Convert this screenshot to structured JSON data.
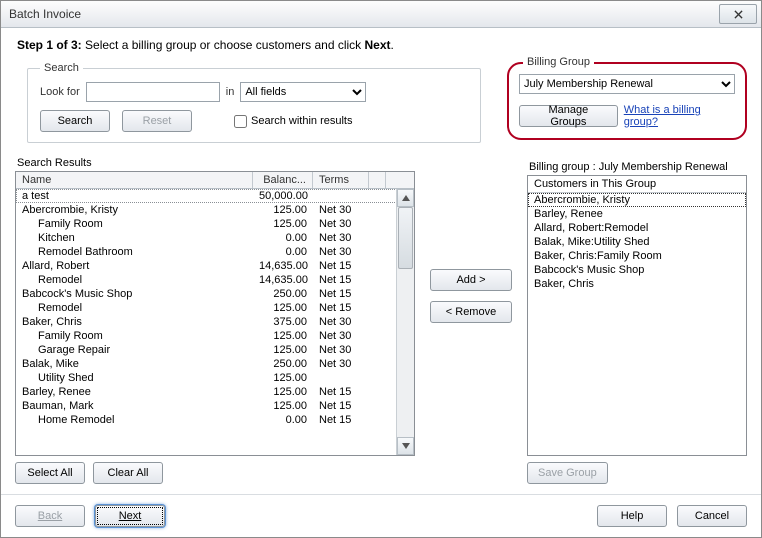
{
  "window": {
    "title": "Batch Invoice"
  },
  "step": {
    "prefix": "Step 1 of 3:",
    "text": " Select a billing group or choose customers and click ",
    "next": "Next",
    "suffix": "."
  },
  "search": {
    "legend": "Search",
    "look_for_label": "Look for",
    "look_for_value": "",
    "in_label": "in",
    "field_options": [
      "All fields"
    ],
    "field_value": "All fields",
    "search_btn": "Search",
    "reset_btn": "Reset",
    "within_label": "Search within results"
  },
  "results": {
    "label": "Search Results",
    "columns": {
      "name": "Name",
      "balance": "Balanc...",
      "terms": "Terms"
    },
    "rows": [
      {
        "name": "a test",
        "balance": "50,000.00",
        "terms": "",
        "indent": 0,
        "selected": true
      },
      {
        "name": "Abercrombie, Kristy",
        "balance": "125.00",
        "terms": "Net 30",
        "indent": 0
      },
      {
        "name": "Family Room",
        "balance": "125.00",
        "terms": "Net 30",
        "indent": 1
      },
      {
        "name": "Kitchen",
        "balance": "0.00",
        "terms": "Net 30",
        "indent": 1
      },
      {
        "name": "Remodel Bathroom",
        "balance": "0.00",
        "terms": "Net 30",
        "indent": 1
      },
      {
        "name": "Allard, Robert",
        "balance": "14,635.00",
        "terms": "Net 15",
        "indent": 0
      },
      {
        "name": "Remodel",
        "balance": "14,635.00",
        "terms": "Net 15",
        "indent": 1
      },
      {
        "name": "Babcock's Music Shop",
        "balance": "250.00",
        "terms": "Net 15",
        "indent": 0
      },
      {
        "name": "Remodel",
        "balance": "125.00",
        "terms": "Net 15",
        "indent": 1
      },
      {
        "name": "Baker, Chris",
        "balance": "375.00",
        "terms": "Net 30",
        "indent": 0
      },
      {
        "name": "Family Room",
        "balance": "125.00",
        "terms": "Net 30",
        "indent": 1
      },
      {
        "name": "Garage Repair",
        "balance": "125.00",
        "terms": "Net 30",
        "indent": 1
      },
      {
        "name": "Balak, Mike",
        "balance": "250.00",
        "terms": "Net 30",
        "indent": 0
      },
      {
        "name": "Utility Shed",
        "balance": "125.00",
        "terms": "",
        "indent": 1
      },
      {
        "name": "Barley, Renee",
        "balance": "125.00",
        "terms": "Net 15",
        "indent": 0
      },
      {
        "name": "Bauman, Mark",
        "balance": "125.00",
        "terms": "Net 15",
        "indent": 0
      },
      {
        "name": "Home Remodel",
        "balance": "0.00",
        "terms": "Net 15",
        "indent": 1
      }
    ],
    "select_all": "Select All",
    "clear_all": "Clear All"
  },
  "transfer": {
    "add": "Add >",
    "remove": "< Remove"
  },
  "billing_group": {
    "legend": "Billing Group",
    "selected": "July Membership Renewal",
    "options": [
      "July Membership Renewal"
    ],
    "manage_btn": "Manage Groups",
    "help_link": "What is a billing group?",
    "list_label_prefix": "Billing group :  ",
    "list_label_value": "July Membership Renewal",
    "list_header": "Customers in This Group",
    "customers": [
      {
        "name": "Abercrombie, Kristy",
        "selected": true
      },
      {
        "name": "Barley, Renee"
      },
      {
        "name": "Allard, Robert:Remodel"
      },
      {
        "name": "Balak, Mike:Utility Shed"
      },
      {
        "name": "Baker, Chris:Family Room"
      },
      {
        "name": "Babcock's Music Shop"
      },
      {
        "name": "Baker, Chris"
      }
    ],
    "save_btn": "Save Group"
  },
  "footer": {
    "back": "Back",
    "next": "Next",
    "help": "Help",
    "cancel": "Cancel"
  },
  "colors": {
    "highlight": "#b00020",
    "link": "#1943b8"
  }
}
